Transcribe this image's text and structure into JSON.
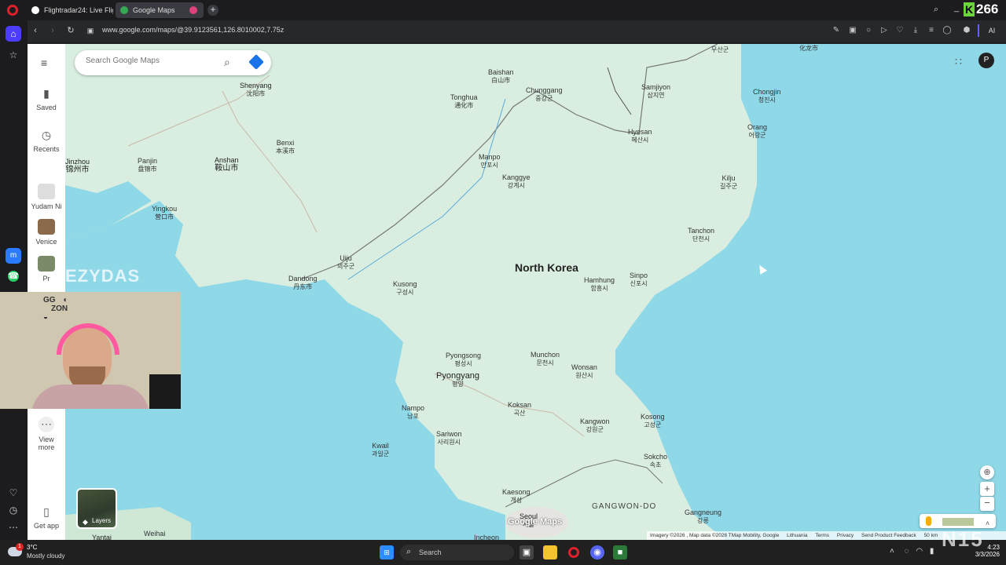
{
  "browser": {
    "tabs": [
      {
        "title": "Flightradar24: Live Flight T"
      },
      {
        "title": "Google Maps"
      }
    ],
    "url": "www.google.com/maps/@39.9123561,126.8010002,7.75z",
    "ai_label": "AI"
  },
  "overlay": {
    "counter": "266",
    "watermark": "EZYDAS",
    "bottom_right": "N15"
  },
  "maps": {
    "search_placeholder": "Search Google Maps",
    "sidebar": {
      "saved": "Saved",
      "recents": "Recents",
      "recent_items": [
        "Yudam Ni",
        "Venice",
        "Pr"
      ],
      "view_more": "View more",
      "get_app": "Get app"
    },
    "layers_label": "Layers",
    "logo": "Google Maps",
    "footer": [
      "Imagery ©2026 , Map data ©2026 TMap Mobility, Google",
      "Lithuania",
      "Terms",
      "Privacy",
      "Send Product Feedback",
      "50 km"
    ],
    "country_label": "North Korea",
    "places": [
      {
        "en": "Shenyang",
        "local": "沈阳市"
      },
      {
        "en": "Benxi",
        "local": "本溪市"
      },
      {
        "en": "Jinzhou",
        "local": "锦州市"
      },
      {
        "en": "Panjin",
        "local": "盘锦市"
      },
      {
        "en": "Anshan",
        "local": "鞍山市"
      },
      {
        "en": "Yingkou",
        "local": "营口市"
      },
      {
        "en": "Baishan",
        "local": "白山市"
      },
      {
        "en": "Tonghua",
        "local": "通化市"
      },
      {
        "en": "Chunggang",
        "local": "중강군"
      },
      {
        "en": "Samjiyon",
        "local": "삼지연"
      },
      {
        "en": "Chongjin",
        "local": "청진시"
      },
      {
        "en": "Hyesan",
        "local": "혜산시"
      },
      {
        "en": "Orang",
        "local": "어랑군"
      },
      {
        "en": "Manpo",
        "local": "만포시"
      },
      {
        "en": "Kanggye",
        "local": "강계시"
      },
      {
        "en": "Kilju",
        "local": "길주군"
      },
      {
        "en": "Tanchon",
        "local": "단천시"
      },
      {
        "en": "Uiju",
        "local": "의주군"
      },
      {
        "en": "Dandong",
        "local": "丹东市"
      },
      {
        "en": "Kusong",
        "local": "구성시"
      },
      {
        "en": "Hamhung",
        "local": "함흥시"
      },
      {
        "en": "Sinpo",
        "local": "신포시"
      },
      {
        "en": "Pyongsong",
        "local": "평성시"
      },
      {
        "en": "Munchon",
        "local": "문천시"
      },
      {
        "en": "Pyongyang",
        "local": "평양"
      },
      {
        "en": "Wonsan",
        "local": "원산시"
      },
      {
        "en": "Nampo",
        "local": "남포"
      },
      {
        "en": "Koksan",
        "local": "곡산"
      },
      {
        "en": "Sariwon",
        "local": "사리원시"
      },
      {
        "en": "Kangwon",
        "local": "강원군"
      },
      {
        "en": "Kosong",
        "local": "고성군"
      },
      {
        "en": "Kwail",
        "local": "과일군"
      },
      {
        "en": "Sokcho",
        "local": "속초"
      },
      {
        "en": "Kaesong",
        "local": "개성"
      },
      {
        "en": "Seoul",
        "local": "서울"
      },
      {
        "en": "Gangneung",
        "local": "강릉"
      },
      {
        "en": "Incheon",
        "local": ""
      },
      {
        "en": "Weihai",
        "local": ""
      },
      {
        "en": "Yantai",
        "local": ""
      }
    ],
    "region_label": "GANGWON-DO",
    "top_labels": [
      "무산군",
      "化龙市"
    ]
  },
  "taskbar": {
    "weather_temp": "3°C",
    "weather_desc": "Mostly cloudy",
    "search_label": "Search",
    "time": "4:23",
    "date": "3/3/2026",
    "notification_count": "1"
  },
  "colors": {
    "land": "#d9eee0",
    "water": "#8fd8e8",
    "accent": "#1a73e8"
  }
}
